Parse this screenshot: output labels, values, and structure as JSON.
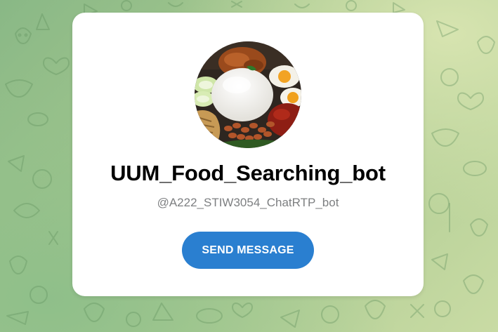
{
  "bot": {
    "name": "UUM_Food_Searching_bot",
    "username": "@A222_STIW3054_ChatRTP_bot",
    "avatar": "nasi-lemak-food-photo"
  },
  "actions": {
    "send_message_label": "SEND MESSAGE"
  },
  "background": {
    "pattern": "telegram-doodle-pattern",
    "colors": [
      "#89b886",
      "#a8c98f",
      "#c9dba4"
    ]
  },
  "colors": {
    "button": "#2a7fd0",
    "username": "#7d7f81"
  }
}
